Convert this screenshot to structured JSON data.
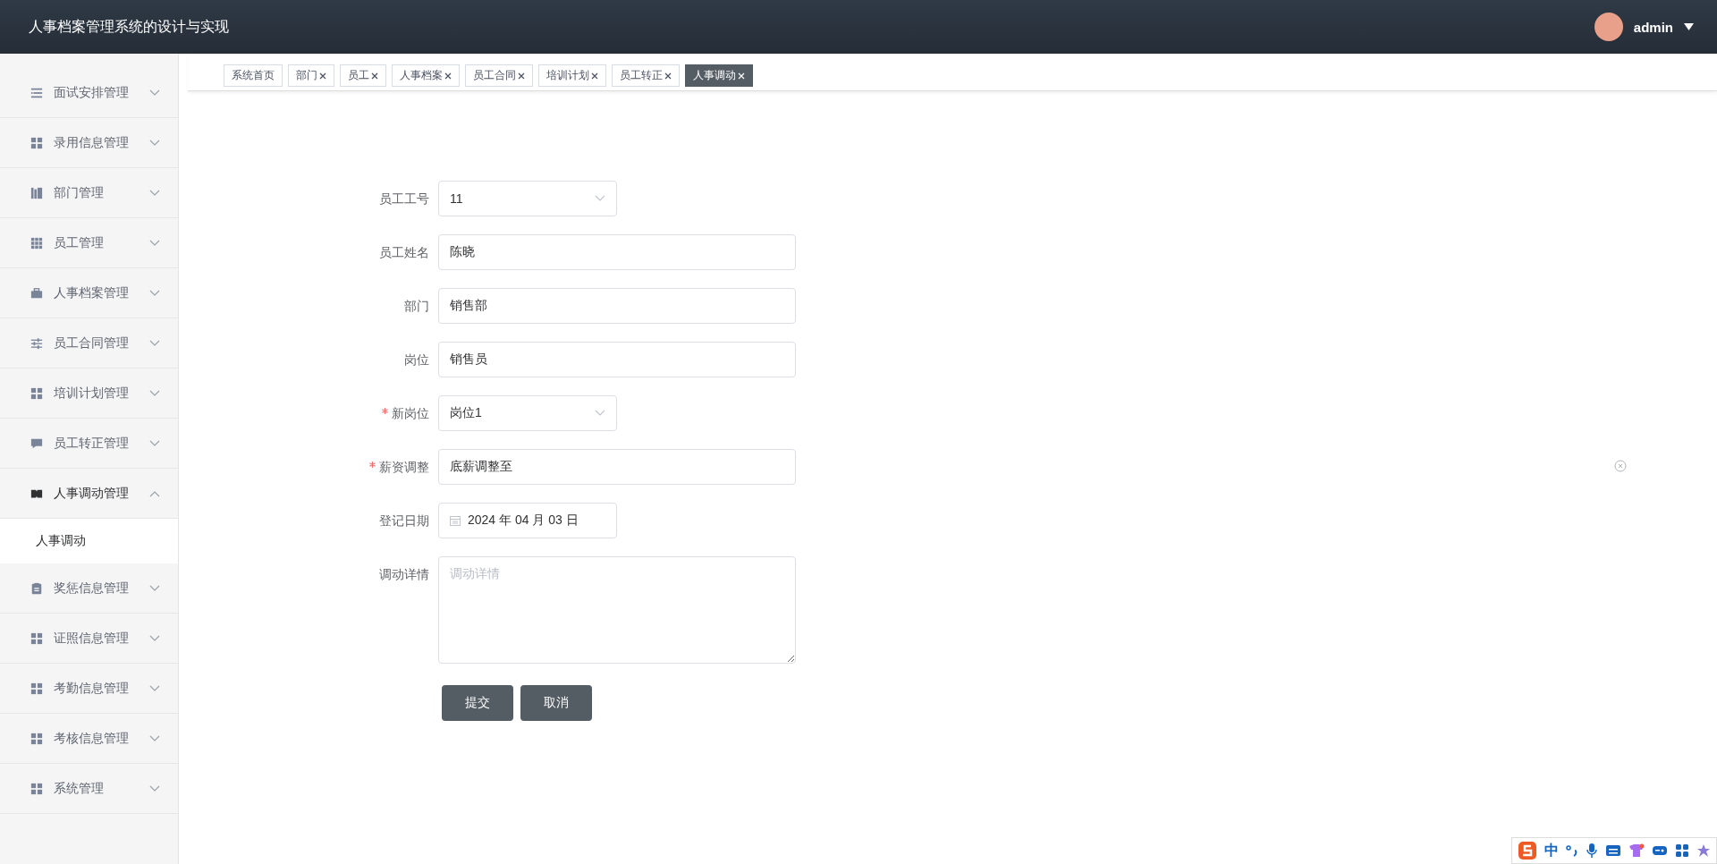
{
  "header": {
    "title": "人事档案管理系统的设计与实现",
    "user": "admin"
  },
  "sidebar": {
    "items": [
      {
        "label": "面试安排管理",
        "expanded": false
      },
      {
        "label": "录用信息管理",
        "expanded": false
      },
      {
        "label": "部门管理",
        "expanded": false
      },
      {
        "label": "员工管理",
        "expanded": false
      },
      {
        "label": "人事档案管理",
        "expanded": false
      },
      {
        "label": "员工合同管理",
        "expanded": false
      },
      {
        "label": "培训计划管理",
        "expanded": false
      },
      {
        "label": "员工转正管理",
        "expanded": false
      },
      {
        "label": "人事调动管理",
        "expanded": true,
        "children": [
          {
            "label": "人事调动",
            "selected": true
          }
        ]
      },
      {
        "label": "奖惩信息管理",
        "expanded": false
      },
      {
        "label": "证照信息管理",
        "expanded": false
      },
      {
        "label": "考勤信息管理",
        "expanded": false
      },
      {
        "label": "考核信息管理",
        "expanded": false
      },
      {
        "label": "系统管理",
        "expanded": false
      }
    ]
  },
  "tabs": [
    {
      "label": "系统首页",
      "closable": false,
      "selected": false
    },
    {
      "label": "部门",
      "closable": true,
      "selected": false
    },
    {
      "label": "员工",
      "closable": true,
      "selected": false
    },
    {
      "label": "人事档案",
      "closable": true,
      "selected": false
    },
    {
      "label": "员工合同",
      "closable": true,
      "selected": false
    },
    {
      "label": "培训计划",
      "closable": true,
      "selected": false
    },
    {
      "label": "员工转正",
      "closable": true,
      "selected": false
    },
    {
      "label": "人事调动",
      "closable": true,
      "selected": true
    }
  ],
  "form": {
    "fields": [
      {
        "kind": "select",
        "label": "员工工号",
        "required": false,
        "value": "11"
      },
      {
        "kind": "input",
        "label": "员工姓名",
        "required": false,
        "value": "陈晓"
      },
      {
        "kind": "input",
        "label": "部门",
        "required": false,
        "value": "销售部"
      },
      {
        "kind": "input",
        "label": "岗位",
        "required": false,
        "value": "销售员"
      },
      {
        "kind": "select",
        "label": "新岗位",
        "required": true,
        "value": "岗位1"
      },
      {
        "kind": "input",
        "label": "薪资调整",
        "required": true,
        "value": "底薪调整至"
      },
      {
        "kind": "date",
        "label": "登记日期",
        "required": false,
        "value": "2024 年 04 月 03 日"
      },
      {
        "kind": "textarea",
        "label": "调动详情",
        "required": false,
        "placeholder": "调动详情"
      }
    ],
    "buttons": [
      "提交",
      "取消"
    ]
  },
  "ime_toolbar": {
    "mode": "中"
  }
}
